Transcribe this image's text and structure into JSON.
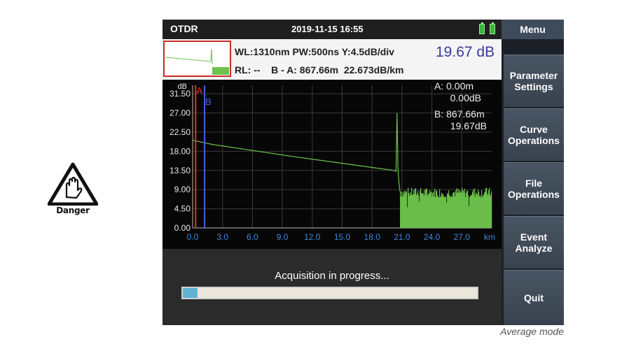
{
  "danger_sign": {
    "label": "Danger"
  },
  "header": {
    "title": "OTDR",
    "datetime": "2019-11-15 16:55"
  },
  "menu": {
    "title": "Menu",
    "items": [
      {
        "label": "Parameter\nSettings"
      },
      {
        "label": "Curve\nOperations"
      },
      {
        "label": "File\nOperations"
      },
      {
        "label": "Event\nAnalyze"
      },
      {
        "label": "Quit"
      }
    ]
  },
  "info": {
    "line1": "WL:1310nm PW:500ns Y:4.5dB/div",
    "line2": "RL: --    B - A: 867.66m  22.673dB/km",
    "loss": "19.67 dB"
  },
  "cursor_readout": {
    "a_pos": "A: 0.00m",
    "a_db": "0.00dB",
    "b_pos": "B: 867.66m",
    "b_db": "19.67dB"
  },
  "cursors": [
    {
      "name": "A",
      "x_km": 0.3,
      "color": "#e03232"
    },
    {
      "name": "B",
      "x_km": 1.2,
      "color": "#4a5ee0"
    }
  ],
  "status": {
    "text": "Acquisition in progress...",
    "progress_fraction": 0.05
  },
  "caption": "Average mode",
  "colors": {
    "trace": "#6cc24a",
    "accent": "#3a3aa0",
    "sidebar": "#3e4b5a"
  },
  "chart_data": {
    "type": "line",
    "ylabel": "dB",
    "xunit": "km",
    "x_ticks": [
      "0.0",
      "3.0",
      "6.0",
      "9.0",
      "12.0",
      "15.0",
      "18.0",
      "21.0",
      "24.0",
      "27.0"
    ],
    "y_ticks": [
      "31.50",
      "27.00",
      "22.50",
      "18.00",
      "13.50",
      "9.00",
      "4.50",
      "0.00"
    ],
    "xlim": [
      0,
      30
    ],
    "ylim": [
      0,
      33.5
    ],
    "series": [
      {
        "values_x": [
          0.0,
          2.0,
          6.0,
          10.0,
          14.0,
          18.0,
          20.2,
          20.4,
          20.5,
          20.6,
          20.7,
          20.8,
          21.0
        ],
        "values_y": [
          20.6,
          19.6,
          18.2,
          16.8,
          15.5,
          14.2,
          13.5,
          13.3,
          27.0,
          14.0,
          10.5,
          8.5,
          8.2
        ]
      }
    ],
    "noise_region": {
      "x_start": 20.8,
      "x_end": 30.0,
      "y_min": 0.0,
      "y_max": 9.5
    }
  }
}
